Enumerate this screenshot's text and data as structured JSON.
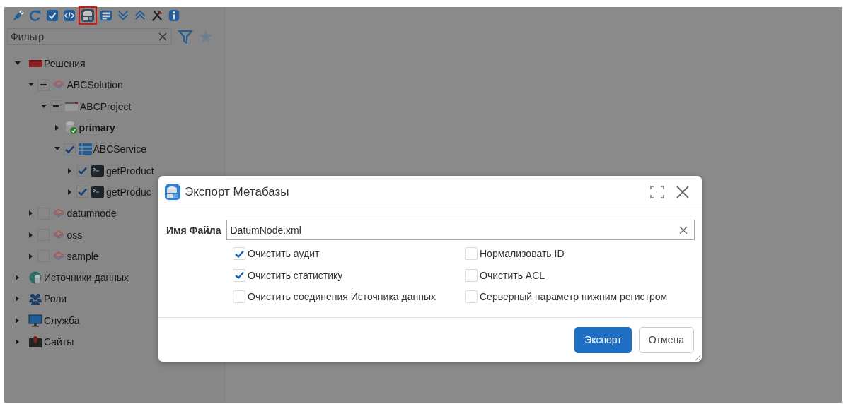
{
  "toolbar": {
    "buttons": [
      {
        "kind": "plug",
        "selected": false
      },
      {
        "kind": "refresh",
        "selected": false
      },
      {
        "kind": "check",
        "selected": false
      },
      {
        "kind": "code",
        "selected": false
      },
      {
        "kind": "database",
        "selected": true
      },
      {
        "kind": "panel",
        "selected": false
      },
      {
        "kind": "collapse-down",
        "selected": false
      },
      {
        "kind": "collapse-up",
        "selected": false
      },
      {
        "kind": "tools",
        "selected": false
      },
      {
        "kind": "info",
        "selected": false
      }
    ]
  },
  "filter": {
    "placeholder": "Фильтр"
  },
  "tree": [
    {
      "label": "Решения",
      "kind": "folder",
      "expanded": true,
      "bold": false,
      "children": [
        {
          "label": "ABCSolution",
          "kind": "layers",
          "expanded": true,
          "checked": false,
          "partial": true,
          "bold": false,
          "children": [
            {
              "label": "ABCProject",
              "kind": "project",
              "expanded": true,
              "checked": false,
              "partial": true,
              "bold": false,
              "children": [
                {
                  "label": "primary",
                  "kind": "db-ok",
                  "expanded": false,
                  "bold": true
                },
                {
                  "label": "ABCService",
                  "kind": "service",
                  "expanded": true,
                  "checked": true,
                  "partial": false,
                  "bold": false,
                  "children": [
                    {
                      "label": "getProduct",
                      "kind": "terminal",
                      "expanded": false,
                      "checked": true,
                      "partial": false,
                      "bold": false
                    },
                    {
                      "label": "getProduc",
                      "kind": "terminal",
                      "expanded": false,
                      "checked": true,
                      "partial": false,
                      "bold": false
                    }
                  ]
                }
              ]
            }
          ]
        },
        {
          "label": "datumnode",
          "kind": "layers",
          "expanded": false,
          "checked": false,
          "partial": false,
          "bold": false
        },
        {
          "label": "oss",
          "kind": "layers",
          "expanded": false,
          "checked": false,
          "partial": false,
          "bold": false
        },
        {
          "label": "sample",
          "kind": "layers",
          "expanded": false,
          "checked": false,
          "partial": false,
          "bold": false
        }
      ]
    },
    {
      "label": "Источники данных",
      "kind": "globe-db",
      "expanded": false,
      "bold": false
    },
    {
      "label": "Роли",
      "kind": "people",
      "expanded": false,
      "bold": false
    },
    {
      "label": "Служба",
      "kind": "monitor",
      "expanded": false,
      "bold": false
    },
    {
      "label": "Сайты",
      "kind": "map",
      "expanded": false,
      "bold": false
    }
  ],
  "dialog": {
    "title": "Экспорт Метабазы",
    "file_field": {
      "label": "Имя Файла",
      "value": "DatumNode.xml"
    },
    "options": [
      {
        "label": "Очистить аудит",
        "checked": true
      },
      {
        "label": "Нормализовать ID",
        "checked": false
      },
      {
        "label": "Очистить статистику",
        "checked": true
      },
      {
        "label": "Очистить ACL",
        "checked": false
      },
      {
        "label": "Очистить соединения Источника данных",
        "checked": false
      },
      {
        "label": "Серверный параметр нижним регистром",
        "checked": false
      }
    ],
    "buttons": [
      {
        "label": "Экспорт",
        "kind": "primary"
      },
      {
        "label": "Отмена",
        "kind": "secondary"
      }
    ]
  }
}
